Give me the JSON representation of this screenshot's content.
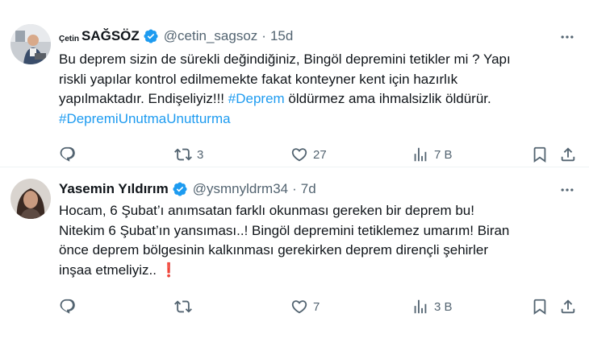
{
  "tweets": [
    {
      "author": {
        "name_prefix": "Çetin",
        "name_main": "SAĞSÖZ",
        "handle": "@cetin_sagsoz",
        "separator": "·",
        "time": "15d",
        "verified": true
      },
      "text_lines": [
        [
          {
            "t": "Bu deprem sizin de sürekli değindiğiniz, Bingöl depremini tetikler mi ? Yapı"
          }
        ],
        [
          {
            "t": "riskli yapılar kontrol edilmemekte fakat konteyner kent için hazırlık"
          }
        ],
        [
          {
            "t": "yapılmaktadır. Endişeliyiz!!! "
          },
          {
            "t": "#Deprem",
            "h": true
          },
          {
            "t": " öldürmez ama ihmalsizlik öldürür."
          }
        ],
        [
          {
            "t": "#DepremiUnutmaUnutturma",
            "h": true
          }
        ]
      ],
      "actions": {
        "replies": "",
        "retweets": "3",
        "likes": "27",
        "views": "7 B"
      }
    },
    {
      "author": {
        "name_prefix": "",
        "name_main": "Yasemin Yıldırım",
        "handle": "@ysmnyldrm34",
        "separator": "·",
        "time": "7d",
        "verified": true
      },
      "text_lines": [
        [
          {
            "t": "Hocam, 6 Şubat’ı anımsatan farklı okunması gereken bir deprem bu!"
          }
        ],
        [
          {
            "t": "Nitekim 6 Şubat’ın yansıması..! Bingöl depremini tetiklemez umarım! Biran"
          }
        ],
        [
          {
            "t": "önce deprem bölgesinin kalkınması gerekirken deprem dirençli şehirler"
          }
        ],
        [
          {
            "t": "inşaa etmeliyiz.. "
          },
          {
            "t": "❗",
            "e": true
          }
        ]
      ],
      "actions": {
        "replies": "",
        "retweets": "",
        "likes": "7",
        "views": "3 B"
      }
    }
  ],
  "colors": {
    "hashtag": "#1d9bf0",
    "muted": "#536471",
    "verified": "#1d9bf0",
    "text": "#0f1419"
  },
  "icons": [
    "more-icon",
    "verified-badge-icon",
    "reply-icon",
    "retweet-icon",
    "like-icon",
    "views-icon",
    "bookmark-icon",
    "share-icon"
  ]
}
